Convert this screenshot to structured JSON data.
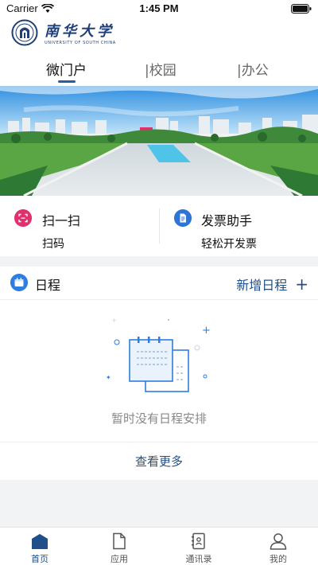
{
  "status_bar": {
    "carrier": "Carrier",
    "time": "1:45 PM"
  },
  "header": {
    "logo_text": "南华大学",
    "logo_subtext": "UNIVERSITY OF SOUTH CHINA",
    "tabs": [
      {
        "label": "微门户",
        "active": true
      },
      {
        "label": "|校园",
        "active": false
      },
      {
        "label": "|办公",
        "active": false
      }
    ]
  },
  "quick_actions": [
    {
      "title": "扫一扫",
      "subtitle": "扫码",
      "icon": "scan-icon",
      "color": "#e0306e"
    },
    {
      "title": "发票助手",
      "subtitle": "轻松开发票",
      "icon": "invoice-icon",
      "color": "#2e74d6"
    }
  ],
  "schedule": {
    "title": "日程",
    "add_label": "新增日程",
    "empty_text": "暂时没有日程安排",
    "view_more": "查看更多"
  },
  "tabbar": [
    {
      "label": "首页",
      "icon": "home-icon",
      "active": true
    },
    {
      "label": "应用",
      "icon": "file-icon",
      "active": false
    },
    {
      "label": "通讯录",
      "icon": "contacts-icon",
      "active": false
    },
    {
      "label": "我的",
      "icon": "user-icon",
      "active": false
    }
  ],
  "colors": {
    "accent": "#1f4f8a",
    "indicator": "#1f5fa6"
  }
}
